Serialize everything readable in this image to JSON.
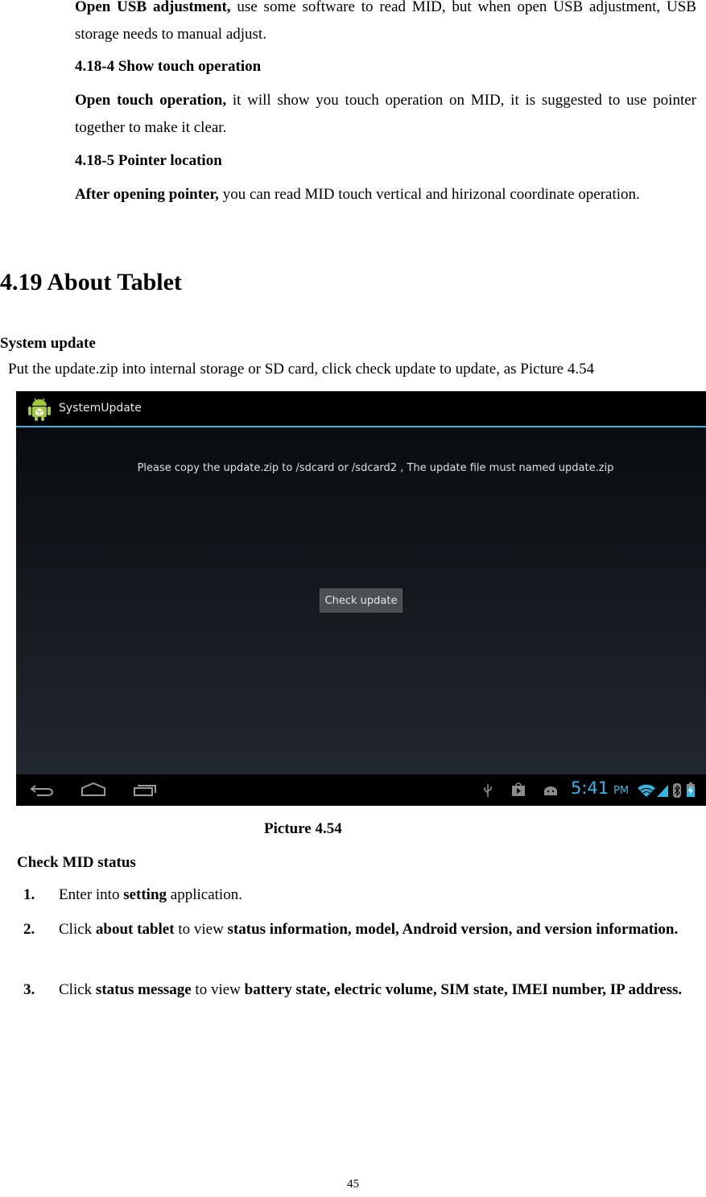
{
  "section_4_18": {
    "usb_para": {
      "lead": "Open USB adjustment,",
      "text": " use some software to read MID, but when open USB adjustment, USB storage needs to manual adjust."
    },
    "sub4_heading": "4.18-4 Show touch operation",
    "touch_para": {
      "lead": "Open touch operation,",
      "text": " it will show you touch operation on MID, it is suggested to use pointer together to make it clear."
    },
    "sub5_heading": "4.18-5 Pointer location",
    "pointer_para": {
      "lead": "After opening pointer,",
      "text": " you can read MID touch vertical and hirizonal coordinate operation."
    }
  },
  "section_4_19": {
    "heading": "4.19 About Tablet",
    "system_update_heading": "System update",
    "system_update_text": "Put the update.zip into internal storage or SD card, click check update to update, as Picture 4.54"
  },
  "screenshot": {
    "app_title": "SystemUpdate",
    "message": "Please copy the update.zip to /sdcard or /sdcard2 , The update file must named update.zip",
    "button_label": "Check update",
    "nav_icons": [
      "back-icon",
      "home-icon",
      "recent-apps-icon"
    ],
    "status_icons": [
      "usb-icon",
      "play-store-icon",
      "android-debug-icon",
      "wifi-icon",
      "signal-icon",
      "bluetooth-icon",
      "battery-charging-icon"
    ],
    "clock": "5:41",
    "ampm": "PM",
    "accent_color": "#33b5e5",
    "icon_color": "#a4c639"
  },
  "caption": "Picture 4.54",
  "check_status": {
    "heading": "Check MID status",
    "steps": [
      {
        "num": "1.",
        "parts": [
          {
            "t": "Enter into ",
            "b": false
          },
          {
            "t": "setting",
            "b": true
          },
          {
            "t": " application.",
            "b": false
          }
        ]
      },
      {
        "num": "2.",
        "parts": [
          {
            "t": "Click ",
            "b": false
          },
          {
            "t": "about tablet",
            "b": true
          },
          {
            "t": " to view ",
            "b": false
          },
          {
            "t": "status information, model, Android version, and version information.",
            "b": true
          }
        ]
      },
      {
        "num": "3.",
        "parts": [
          {
            "t": "Click ",
            "b": false
          },
          {
            "t": "status message",
            "b": true
          },
          {
            "t": " to view ",
            "b": false
          },
          {
            "t": "battery state, electric volume, SIM state, IMEI number, IP address.",
            "b": true
          }
        ]
      }
    ]
  },
  "page_number": "45"
}
